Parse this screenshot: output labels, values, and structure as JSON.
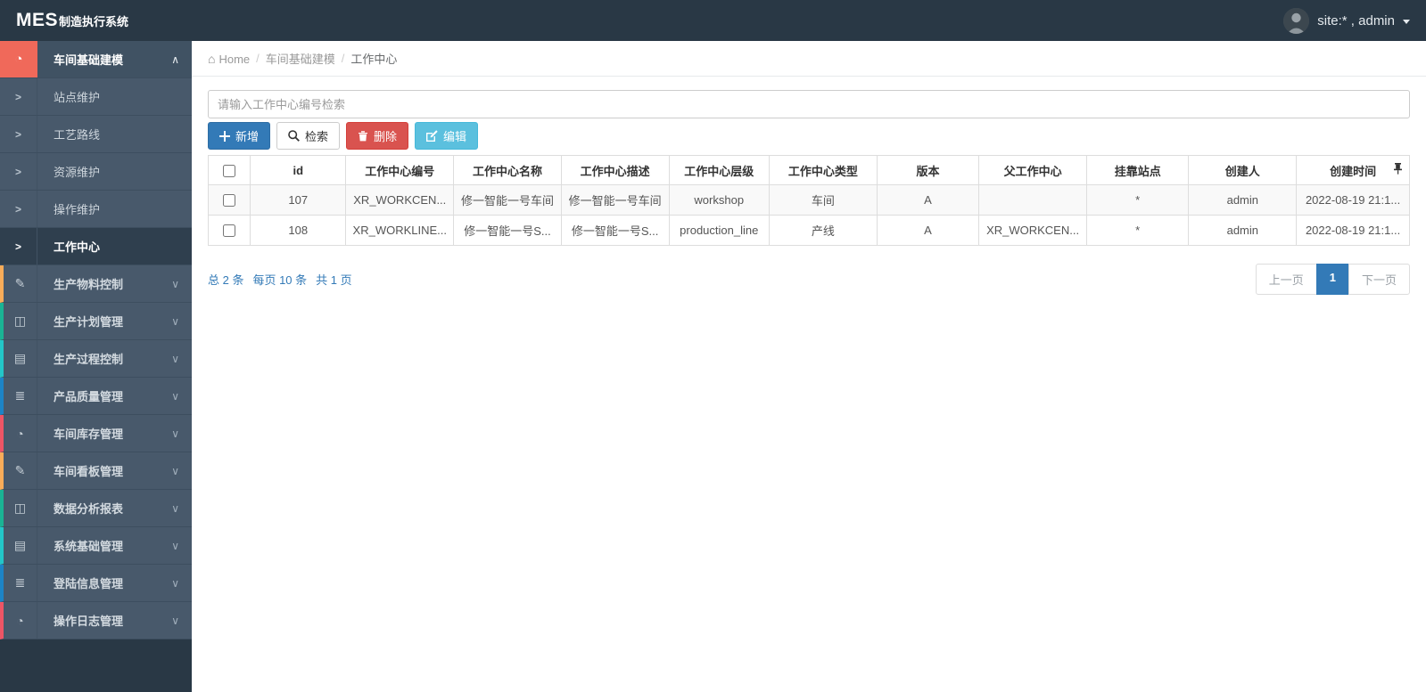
{
  "topbar": {
    "brand_bold": "MES",
    "brand_rest": "制造执行系统",
    "user_label": "site:* , admin"
  },
  "sidebar": {
    "parent_item": {
      "label": "车间基础建模",
      "icon": "dashboard-icon",
      "icon_bg": "#f0695a"
    },
    "sub_items": [
      {
        "label": "站点维护",
        "active": false
      },
      {
        "label": "工艺路线",
        "active": false
      },
      {
        "label": "资源维护",
        "active": false
      },
      {
        "label": "操作维护",
        "active": false
      },
      {
        "label": "工作中心",
        "active": true
      }
    ],
    "collapsed_items": [
      {
        "label": "生产物料控制",
        "icon": "edit-icon",
        "accent": "#f8ac59"
      },
      {
        "label": "生产计划管理",
        "icon": "columns-icon",
        "accent": "#1ab394"
      },
      {
        "label": "生产过程控制",
        "icon": "book-icon",
        "accent": "#23c6c8"
      },
      {
        "label": "产品质量管理",
        "icon": "list-icon",
        "accent": "#1c84c6"
      },
      {
        "label": "车间库存管理",
        "icon": "dashboard-icon",
        "accent": "#ed5565"
      },
      {
        "label": "车间看板管理",
        "icon": "edit-icon",
        "accent": "#f8ac59"
      },
      {
        "label": "数据分析报表",
        "icon": "columns-icon",
        "accent": "#1ab394"
      },
      {
        "label": "系统基础管理",
        "icon": "book-icon",
        "accent": "#23c6c8"
      },
      {
        "label": "登陆信息管理",
        "icon": "list-icon",
        "accent": "#1c84c6"
      },
      {
        "label": "操作日志管理",
        "icon": "dashboard-icon",
        "accent": "#ed5565"
      }
    ]
  },
  "breadcrumb": {
    "items": [
      "Home",
      "车间基础建模",
      "工作中心"
    ]
  },
  "toolbar": {
    "search_placeholder": "请输入工作中心编号检索",
    "add_label": "新增",
    "search_label": "检索",
    "delete_label": "删除",
    "edit_label": "编辑"
  },
  "table": {
    "columns": [
      "id",
      "工作中心编号",
      "工作中心名称",
      "工作中心描述",
      "工作中心层级",
      "工作中心类型",
      "版本",
      "父工作中心",
      "挂靠站点",
      "创建人",
      "创建时间"
    ],
    "rows": [
      [
        "107",
        "XR_WORKCEN...",
        "修一智能一号车间",
        "修一智能一号车间",
        "workshop",
        "车间",
        "A",
        "",
        "*",
        "admin",
        "2022-08-19 21:1..."
      ],
      [
        "108",
        "XR_WORKLINE...",
        "修一智能一号S...",
        "修一智能一号S...",
        "production_line",
        "产线",
        "A",
        "XR_WORKCEN...",
        "*",
        "admin",
        "2022-08-19 21:1..."
      ]
    ]
  },
  "pagination": {
    "total_text": "总 2 条",
    "per_page_text": "每页 10 条",
    "pages_text": "共 1 页",
    "prev_label": "上一页",
    "current_page": "1",
    "next_label": "下一页"
  },
  "colors": {
    "topbar_bg": "#293845",
    "sidebar_item_bg": "#48596b",
    "active_item_bg": "#2f3f4e",
    "parent_icon_bg": "#f0695a",
    "accent_blue": "#337ab7",
    "danger_red": "#d9534f",
    "info_blue": "#5bc0de"
  }
}
